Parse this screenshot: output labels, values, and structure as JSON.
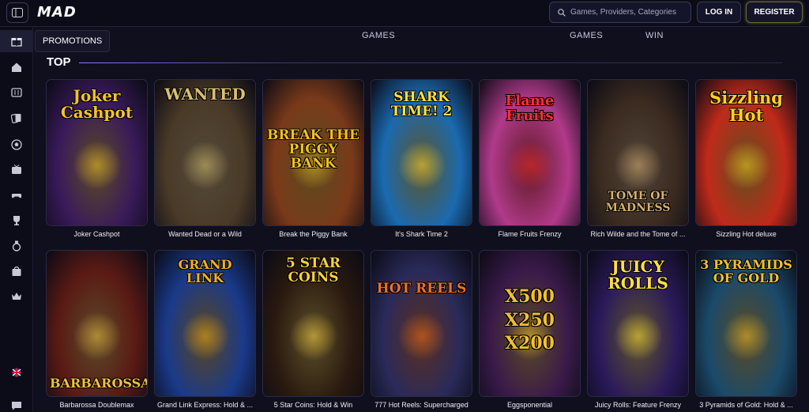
{
  "header": {
    "logo": "MAD",
    "search_placeholder": "Games, Providers, Categories",
    "login_label": "LOG IN",
    "register_label": "REGISTER"
  },
  "sidebar": {
    "tooltip": "PROMOTIONS",
    "icons": [
      "gift-icon",
      "home-icon",
      "slot-machine-icon",
      "cards-icon",
      "football-icon",
      "tv-icon",
      "gamepad-icon",
      "trophy-icon",
      "medal-icon",
      "bag-icon",
      "crown-icon",
      "flag-uk-icon",
      "chat-icon"
    ]
  },
  "top_labels": [
    "GAMES",
    "GAMES",
    "WIN"
  ],
  "section": {
    "title": "TOP"
  },
  "games": [
    {
      "label": "Joker Cashpot",
      "art": "Joker Cashpot",
      "bg": "#3a1a5a",
      "accent": "#f2c230"
    },
    {
      "label": "Wanted Dead or a Wild",
      "art": "WANTED",
      "bg": "#4a3a28",
      "accent": "#d8c070"
    },
    {
      "label": "Break the Piggy Bank",
      "art": "BREAK THE PIGGY BANK",
      "bg": "#7a3a1a",
      "accent": "#f0c020"
    },
    {
      "label": "It's Shark Time 2",
      "art": "SHARK TIME! 2",
      "bg": "#1a6ab0",
      "accent": "#ffe040"
    },
    {
      "label": "Flame Fruits Frenzy",
      "art": "Flame Fruits",
      "bg": "#b03a8a",
      "accent": "#ff3030"
    },
    {
      "label": "Rich Wilde and the Tome of ...",
      "art": "TOME OF MADNESS",
      "bg": "#3a2a20",
      "accent": "#d8b070"
    },
    {
      "label": "Sizzling Hot deluxe",
      "art": "Sizzling Hot",
      "bg": "#c02a1a",
      "accent": "#ffd020"
    },
    {
      "label": "Barbarossa Doublemax",
      "art": "BARBAROSSA",
      "bg": "#5a1a14",
      "accent": "#f0c040"
    },
    {
      "label": "Grand Link Express: Hold & ...",
      "art": "GRAND LINK",
      "bg": "#1a3a8a",
      "accent": "#f0b020"
    },
    {
      "label": "5 Star Coins: Hold & Win",
      "art": "5 STAR COINS",
      "bg": "#2a1a10",
      "accent": "#f8d040"
    },
    {
      "label": "777 Hot Reels: Supercharged",
      "art": "HOT REELS",
      "bg": "#2a2a5a",
      "accent": "#f07020"
    },
    {
      "label": "Eggsponential",
      "art": "X500 X250 X200",
      "bg": "#3a1a4a",
      "accent": "#f0c030"
    },
    {
      "label": "Juicy Rolls: Feature Frenzy",
      "art": "JUICY ROLLS",
      "bg": "#2a1a5a",
      "accent": "#ffe040"
    },
    {
      "label": "3 Pyramids of Gold: Hold & ...",
      "art": "3 PYRAMIDS OF GOLD",
      "bg": "#1a4a6a",
      "accent": "#f0c030"
    }
  ],
  "colors": {
    "background": "#0f0f1e",
    "header": "#0c0c18",
    "register_glow": "#dcdc78"
  }
}
